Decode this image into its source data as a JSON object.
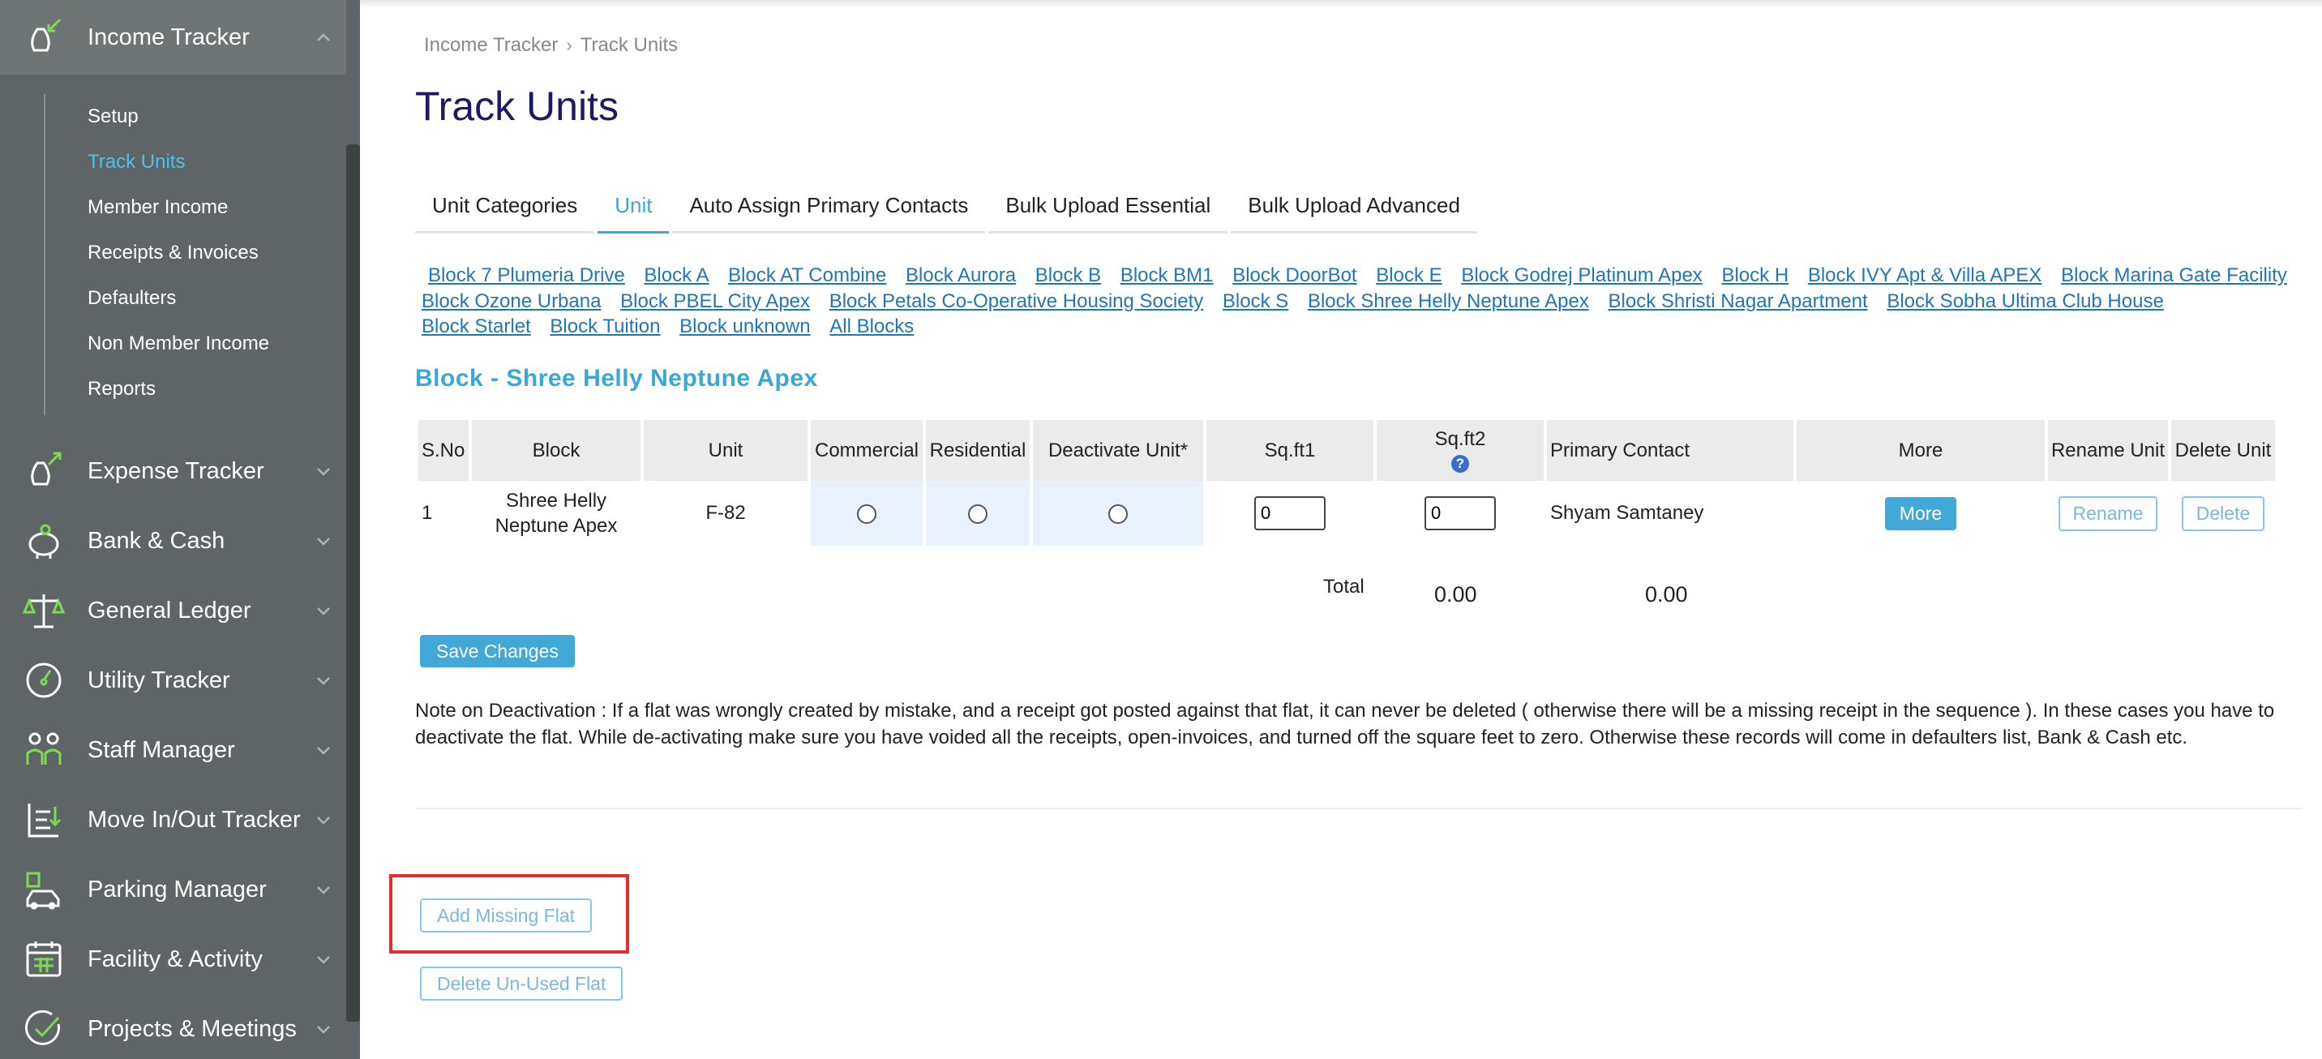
{
  "sidebar": {
    "income_tracker": {
      "label": "Income Tracker",
      "items": [
        {
          "label": "Setup"
        },
        {
          "label": "Track Units"
        },
        {
          "label": "Member Income"
        },
        {
          "label": "Receipts & Invoices"
        },
        {
          "label": "Defaulters"
        },
        {
          "label": "Non Member Income"
        },
        {
          "label": "Reports"
        }
      ]
    },
    "modules": [
      {
        "label": "Expense Tracker",
        "icon": "expense-icon"
      },
      {
        "label": "Bank & Cash",
        "icon": "piggy-bank-icon"
      },
      {
        "label": "General Ledger",
        "icon": "scale-icon"
      },
      {
        "label": "Utility Tracker",
        "icon": "meter-icon"
      },
      {
        "label": "Staff Manager",
        "icon": "staff-icon"
      },
      {
        "label": "Move In/Out Tracker",
        "icon": "move-icon"
      },
      {
        "label": "Parking Manager",
        "icon": "car-icon"
      },
      {
        "label": "Facility & Activity",
        "icon": "calendar-icon"
      },
      {
        "label": "Projects & Meetings",
        "icon": "check-icon"
      }
    ]
  },
  "breadcrumb": {
    "root": "Income Tracker",
    "current": "Track Units"
  },
  "page_title": "Track Units",
  "tabs": [
    {
      "label": "Unit Categories",
      "active": false
    },
    {
      "label": "Unit",
      "active": true
    },
    {
      "label": "Auto Assign Primary Contacts",
      "active": false
    },
    {
      "label": "Bulk Upload Essential",
      "active": false
    },
    {
      "label": "Bulk Upload Advanced",
      "active": false
    }
  ],
  "block_links": [
    "Block 7 Plumeria Drive",
    "Block A",
    "Block AT Combine",
    "Block Aurora",
    "Block B",
    "Block BM1",
    "Block DoorBot",
    "Block E",
    "Block Godrej Platinum Apex",
    "Block H",
    "Block IVY Apt & Villa APEX",
    "Block Marina Gate Facility",
    "Block Ozone Urbana",
    "Block PBEL City Apex",
    "Block Petals Co-Operative Housing Society",
    "Block S",
    "Block Shree Helly Neptune Apex",
    "Block Shristi Nagar Apartment",
    "Block Sobha Ultima Club House",
    "Block Starlet",
    "Block Tuition",
    "Block unknown",
    "All Blocks"
  ],
  "block_heading": "Block - Shree Helly Neptune Apex",
  "table": {
    "headers": {
      "sno": "S.No",
      "block": "Block",
      "unit": "Unit",
      "commercial": "Commercial",
      "residential": "Residential",
      "deactivate": "Deactivate Unit*",
      "sqft1": "Sq.ft1",
      "sqft2": "Sq.ft2",
      "primary": "Primary Contact",
      "more": "More",
      "rename": "Rename Unit",
      "delete": "Delete Unit"
    },
    "row": {
      "sno": "1",
      "block": "Shree Helly Neptune Apex",
      "unit": "F-82",
      "sqft1": "0",
      "sqft2": "0",
      "primary": "Shyam Samtaney",
      "more_btn": "More",
      "rename_btn": "Rename",
      "delete_btn": "Delete"
    }
  },
  "totals": {
    "label": "Total",
    "sqft1": "0.00",
    "sqft2": "0.00"
  },
  "save_button": "Save Changes",
  "note": "Note on Deactivation : If a flat was wrongly created by mistake, and a receipt got posted against that flat, it can never be deleted ( otherwise there will be a missing receipt in the sequence ). In these cases you have to deactivate the flat. While de-activating make sure you have voided all the receipts, open-invoices, and turned off the square feet to zero. Otherwise these records will come in defaulters list, Bank & Cash etc.",
  "add_missing_flat": "Add Missing Flat",
  "delete_unused_flat": "Delete Un-Used Flat",
  "colors": {
    "sidebar_bg": "#5f6566",
    "accent": "#3aa7d8",
    "title": "#1c1a62",
    "icon_green": "#7ed957",
    "highlight": "#e0302b"
  }
}
